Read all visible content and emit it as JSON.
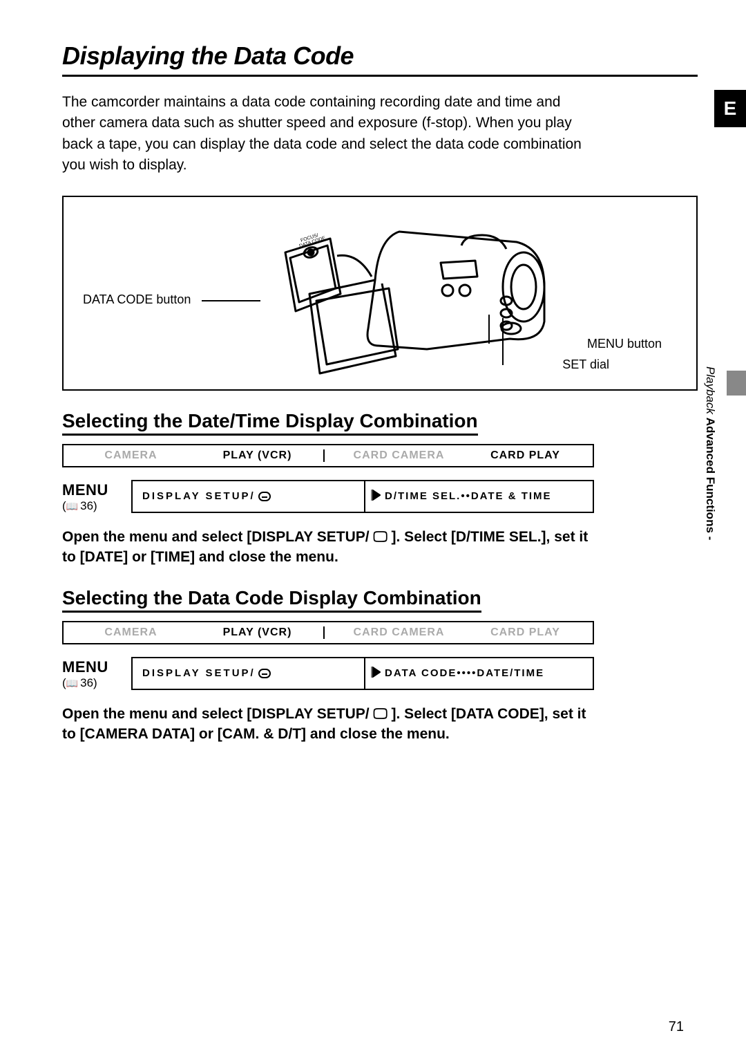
{
  "pageNumber": "71",
  "sideTab": "E",
  "sideText": {
    "category": "Advanced Functions -",
    "sub": "Playback"
  },
  "title": "Displaying the Data Code",
  "intro": "The camcorder maintains a data code containing recording date and time and other camera data such as shutter speed and exposure (f-stop). When you play back a tape, you can display the data code and select the data code combination you wish to display.",
  "illus": {
    "dataCodeLabel": "DATA CODE button",
    "menuLabel": "MENU button",
    "setLabel": "SET dial"
  },
  "section1": {
    "heading": "Selecting the Date/Time Display Combination",
    "modes": {
      "m1": "CAMERA",
      "m2": "PLAY (VCR)",
      "m3": "CARD CAMERA",
      "m4": "CARD PLAY"
    },
    "menuWord": "MENU",
    "menuRef": "36",
    "menuLeft": "DISPLAY SETUP/",
    "menuRight": "D/TIME SEL.••DATE & TIME",
    "instruction": "Open the menu and select [DISPLAY SETUP/ 🖵 ]. Select [D/TIME SEL.], set it to [DATE] or [TIME] and close the menu."
  },
  "section2": {
    "heading": "Selecting the Data Code Display Combination",
    "modes": {
      "m1": "CAMERA",
      "m2": "PLAY (VCR)",
      "m3": "CARD CAMERA",
      "m4": "CARD PLAY"
    },
    "menuWord": "MENU",
    "menuRef": "36",
    "menuLeft": "DISPLAY SETUP/",
    "menuRight": "DATA CODE••••DATE/TIME",
    "instruction": "Open the menu and select [DISPLAY SETUP/ 🖵 ]. Select [DATA CODE], set it to [CAMERA DATA] or [CAM. & D/T] and close the menu."
  }
}
